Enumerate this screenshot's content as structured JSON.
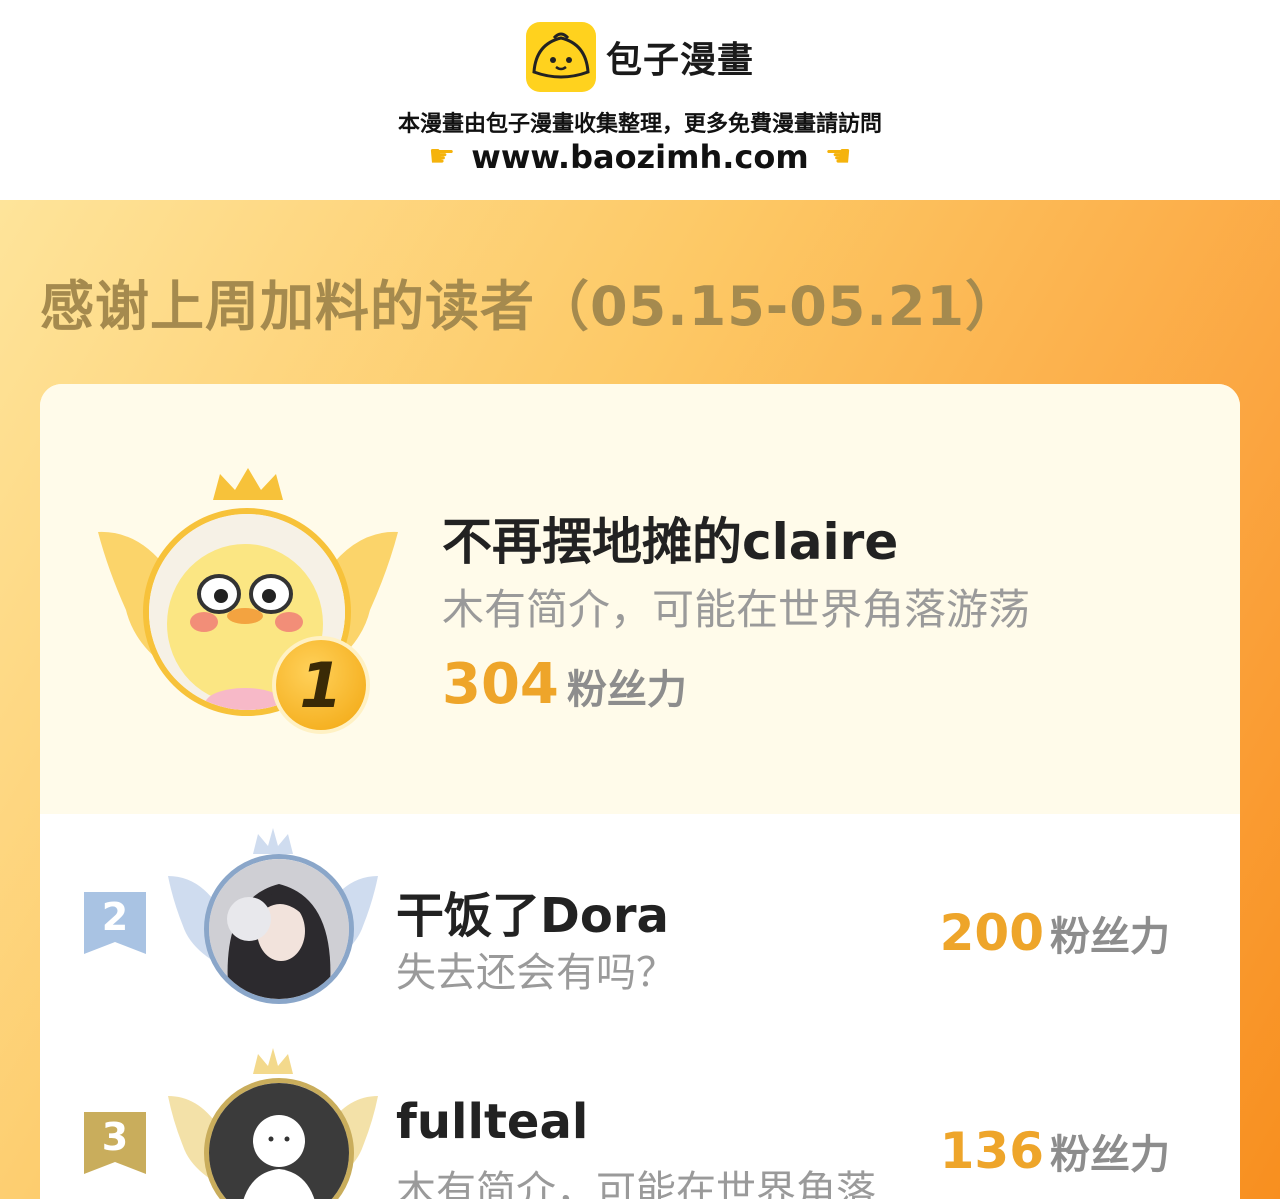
{
  "header": {
    "logo_text": "包子漫畫",
    "notice": "本漫畫由包子漫畫收集整理，更多免費漫畫請訪問",
    "url": "www.baozimh.com"
  },
  "poster": {
    "title": "感谢上周加料的读者（05.15-05.21）",
    "colors": {
      "gold": "#eea52a",
      "title": "#a58a4e",
      "bg_start": "#fee49a",
      "bg_end": "#f88f1f"
    },
    "leaders": [
      {
        "rank": "1",
        "name": "不再摆地摊的claire",
        "bio": "木有简介，可能在世界角落游荡",
        "score": "304",
        "unit": "粉丝力"
      },
      {
        "rank": "2",
        "name": "干饭了Dora",
        "bio": "失去还会有吗？",
        "score": "200",
        "unit": "粉丝力"
      },
      {
        "rank": "3",
        "name": "fullteal",
        "bio": "木有简介，可能在世界角落...",
        "score": "136",
        "unit": "粉丝力"
      }
    ]
  }
}
